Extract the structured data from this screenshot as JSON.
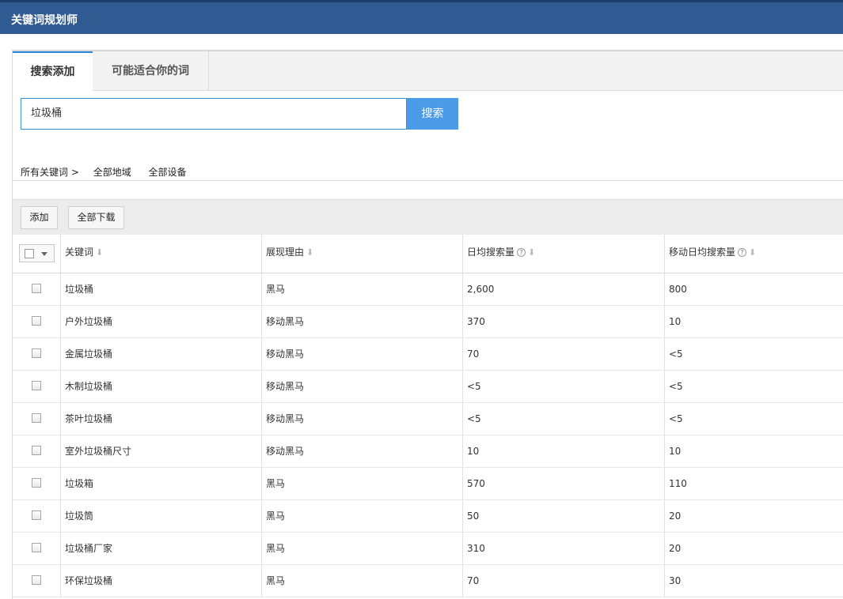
{
  "app": {
    "title": "关键词规划师"
  },
  "tabs": [
    {
      "label": "搜索添加",
      "active": true
    },
    {
      "label": "可能适合你的词",
      "active": false
    }
  ],
  "search": {
    "value": "垃圾桶",
    "button_label": "搜索"
  },
  "filters": {
    "breadcrumb": "所有关键词 >",
    "region": "全部地域",
    "device": "全部设备"
  },
  "toolbar": {
    "add_label": "添加",
    "download_label": "全部下载"
  },
  "columns": [
    {
      "label": "关键词",
      "sort_icon": "arrow-down-icon",
      "help": false
    },
    {
      "label": "展现理由",
      "sort_icon": "arrow-down-icon",
      "help": false
    },
    {
      "label": "日均搜索量",
      "sort_icon": "arrow-down-icon",
      "help": true
    },
    {
      "label": "移动日均搜索量",
      "sort_icon": "arrow-down-icon",
      "help": true
    }
  ],
  "rows": [
    {
      "keyword": "垃圾桶",
      "reason": "黑马",
      "daily": "2,600",
      "mobile": "800"
    },
    {
      "keyword": "户外垃圾桶",
      "reason": "移动黑马",
      "daily": "370",
      "mobile": "10"
    },
    {
      "keyword": "金属垃圾桶",
      "reason": "移动黑马",
      "daily": "70",
      "mobile": "<5"
    },
    {
      "keyword": "木制垃圾桶",
      "reason": "移动黑马",
      "daily": "<5",
      "mobile": "<5"
    },
    {
      "keyword": "茶叶垃圾桶",
      "reason": "移动黑马",
      "daily": "<5",
      "mobile": "<5"
    },
    {
      "keyword": "室外垃圾桶尺寸",
      "reason": "移动黑马",
      "daily": "10",
      "mobile": "10"
    },
    {
      "keyword": "垃圾箱",
      "reason": "黑马",
      "daily": "570",
      "mobile": "110"
    },
    {
      "keyword": "垃圾筒",
      "reason": "黑马",
      "daily": "50",
      "mobile": "20"
    },
    {
      "keyword": "垃圾桶厂家",
      "reason": "黑马",
      "daily": "310",
      "mobile": "20"
    },
    {
      "keyword": "环保垃圾桶",
      "reason": "黑马",
      "daily": "70",
      "mobile": "30"
    }
  ],
  "colors": {
    "header_bg": "#2f5b92",
    "accent": "#4b9be8",
    "tab_active_border": "#2d86d8"
  }
}
